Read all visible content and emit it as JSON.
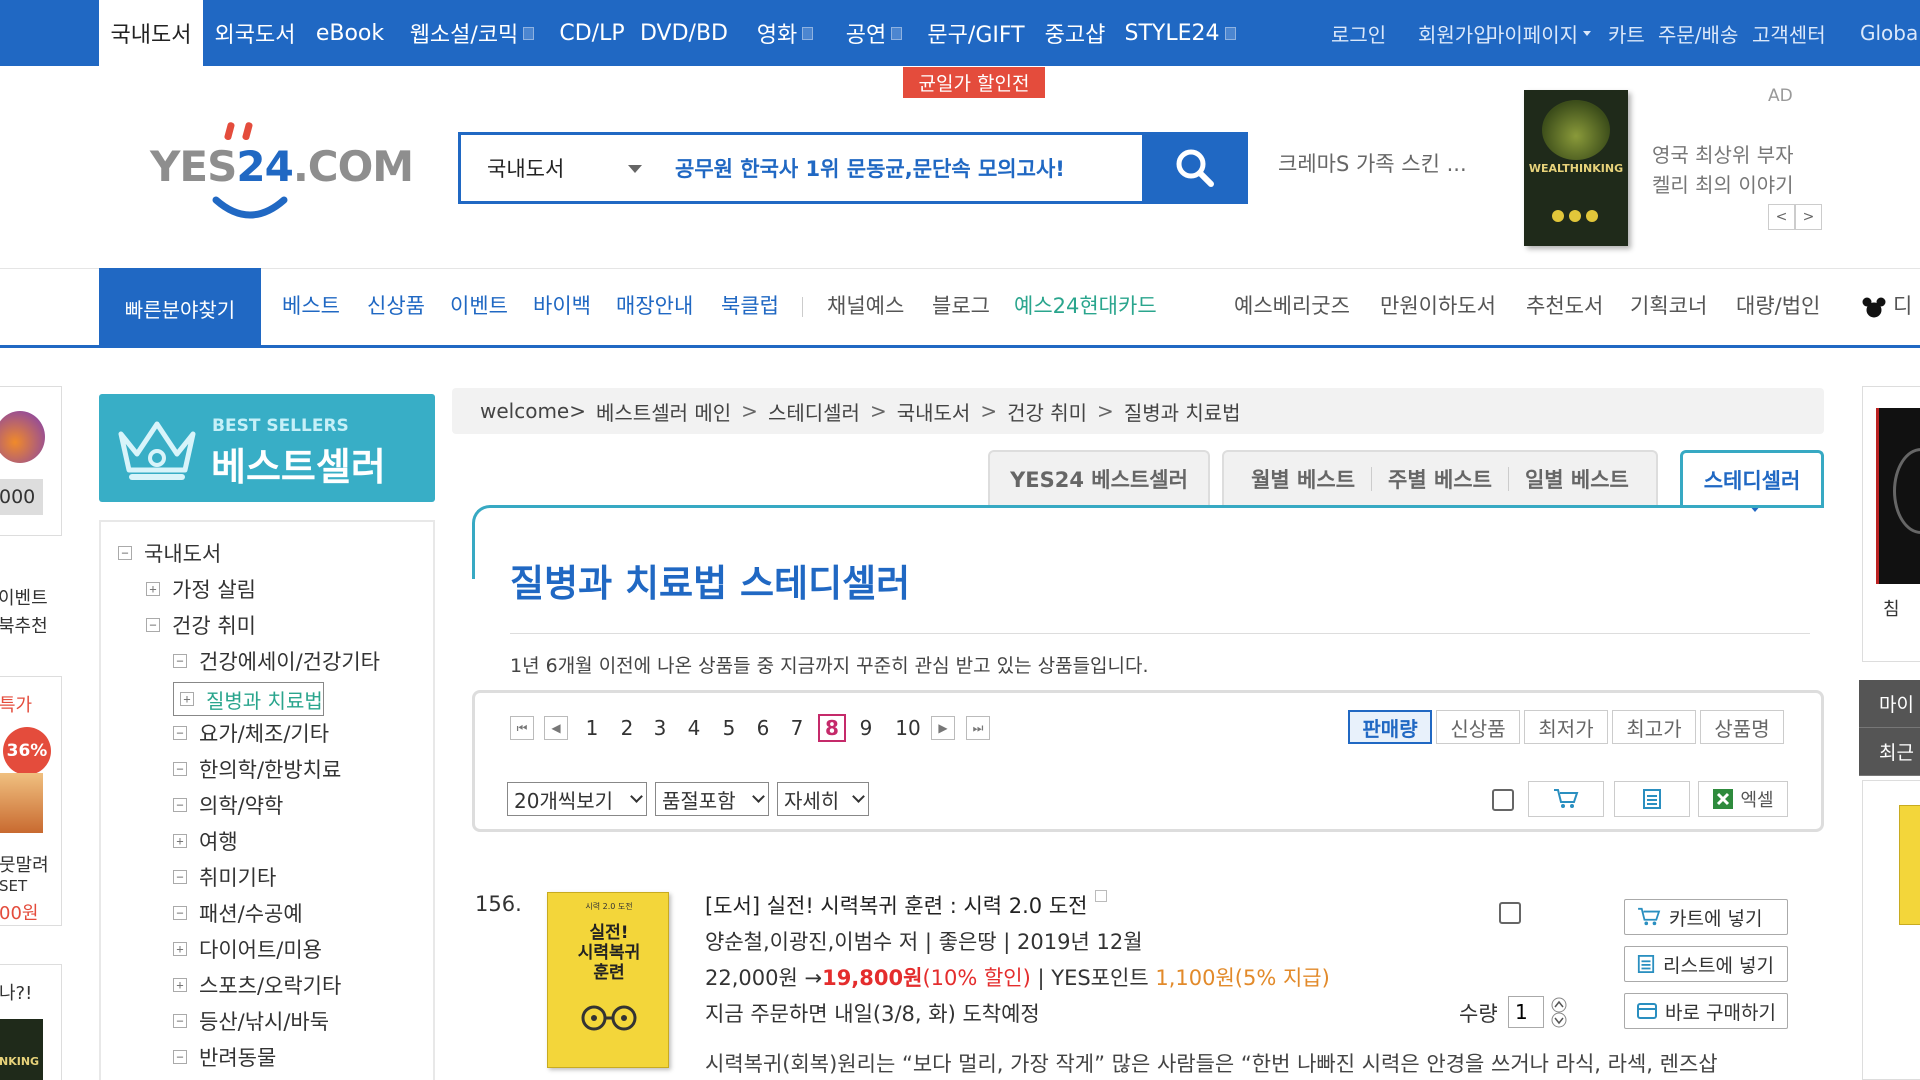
{
  "topbar": {
    "categories": [
      "국내도서",
      "외국도서",
      "eBook",
      "웹소설/코믹",
      "CD/LP",
      "DVD/BD",
      "영화",
      "공연",
      "문구/GIFT",
      "중고샵",
      "STYLE24"
    ],
    "util": [
      "로그인",
      "회원가입",
      "마이페이지",
      "카트",
      "주문/배송",
      "고객센터",
      "Globa"
    ],
    "promo_badge": "균일가 할인전"
  },
  "header": {
    "logo_prefix": "YES",
    "logo_num": "24",
    "logo_suffix": ".COM",
    "search_category": "국내도서",
    "search_placeholder": "공무원 한국사 1위 문동균,문단속 모의고사!",
    "hot_keyword": "크레마S 가족 스킨 ...",
    "ad_tag": "AD",
    "ad_book_title": "WEALTHINKING",
    "ad_line1": "영국 최상위 부자",
    "ad_line2": "켈리 최의 이야기",
    "ad_prev": "<",
    "ad_next": ">"
  },
  "nav": {
    "quick": "빠른분야찾기",
    "items_blue": [
      "베스트",
      "신상품",
      "이벤트",
      "바이백",
      "매장안내",
      "북클럽"
    ],
    "items_gray": [
      "채널예스",
      "블로그"
    ],
    "item_green": "예스24현대카드",
    "items_right": [
      "예스베리굿즈",
      "만원이하도서",
      "추천도서",
      "기획코너",
      "대량/법인",
      "디"
    ]
  },
  "left_edge": {
    "amount": "000",
    "event1": "이벤트",
    "event2": "북추천",
    "special": "특가",
    "discount": "36%",
    "text1": "뭇말려",
    "text2": "SET",
    "price": "00원",
    "text3": "나?!",
    "book": "NKING"
  },
  "sidebar": {
    "banner_small": "BEST SELLERS",
    "banner_big": "베스트셀러",
    "root": "국내도서",
    "items": [
      {
        "label": "가정 살림",
        "sign": "+"
      },
      {
        "label": "건강 취미",
        "sign": "−"
      },
      {
        "label": "건강에세이/건강기타",
        "sign": "−"
      },
      {
        "label": "질병과 치료법",
        "sign": "+"
      },
      {
        "label": "요가/체조/기타",
        "sign": "−"
      },
      {
        "label": "한의학/한방치료",
        "sign": "−"
      },
      {
        "label": "의학/약학",
        "sign": "−"
      },
      {
        "label": "여행",
        "sign": "+"
      },
      {
        "label": "취미기타",
        "sign": "−"
      },
      {
        "label": "패션/수공예",
        "sign": "−"
      },
      {
        "label": "다이어트/미용",
        "sign": "+"
      },
      {
        "label": "스포츠/오락기타",
        "sign": "+"
      },
      {
        "label": "등산/낚시/바둑",
        "sign": "−"
      },
      {
        "label": "반려동물",
        "sign": "−"
      }
    ]
  },
  "breadcrumb": [
    "welcome>",
    "베스트셀러 메인",
    "스테디셀러",
    "국내도서",
    "건강 취미",
    "질병과 치료법"
  ],
  "tabs": {
    "yes24": "YES24 베스트셀러",
    "monthly": "월별 베스트",
    "weekly": "주별 베스트",
    "daily": "일별 베스트",
    "steady": "스테디셀러"
  },
  "main": {
    "title": "질병과 치료법 스테디셀러",
    "desc": "1년 6개월 이전에 나온 상품들 중 지금까지 꾸준히 관심 받고 있는 상품들입니다."
  },
  "pagination": {
    "pages": [
      "1",
      "2",
      "3",
      "4",
      "5",
      "6",
      "7",
      "8",
      "9",
      "10"
    ],
    "current": "8"
  },
  "sort": [
    "판매량",
    "신상품",
    "최저가",
    "최고가",
    "상품명"
  ],
  "view": {
    "per_page": "20개씩보기",
    "soldout": "품절포함",
    "detail": "자세히",
    "excel": "엑셀"
  },
  "product": {
    "rank": "156.",
    "cover_tiny": "시력 2.0 도전",
    "cover_title1": "실전!",
    "cover_title2": "시력복귀",
    "cover_title3": "훈련",
    "title": "[도서] 실전! 시력복귀 훈련 : 시력 2.0 도전",
    "meta": "양순철,이광진,이범수 저 | 좋은땅 | 2019년 12월",
    "price_orig": "22,000원 →",
    "price_sale": "19,800원",
    "price_disc": "(10% 할인)",
    "points_label": " | YES포인트 ",
    "points": "1,100원",
    "points_rate": "(5% 지급)",
    "shipping": "지금 주문하면 내일(3/8, 화) 도착예정",
    "qty_label": "수량",
    "qty": "1",
    "cart_btn": "카트에 넣기",
    "list_btn": "리스트에 넣기",
    "buy_btn": "바로 구매하기",
    "desc": "시력복귀(회복)원리는 “보다 멀리, 가장 작게” 많은 사람들은 “한번 나빠진 시력은 안경을 쓰거나 라식, 라섹, 렌즈삽"
  },
  "right_edge": {
    "caption": "침",
    "menu1": "마이",
    "menu2": "최근"
  },
  "colors": {
    "brand_blue": "#2068c3",
    "accent_teal": "#37a9c3",
    "sale_red": "#e42d2d",
    "current_page": "#c52a6a"
  }
}
